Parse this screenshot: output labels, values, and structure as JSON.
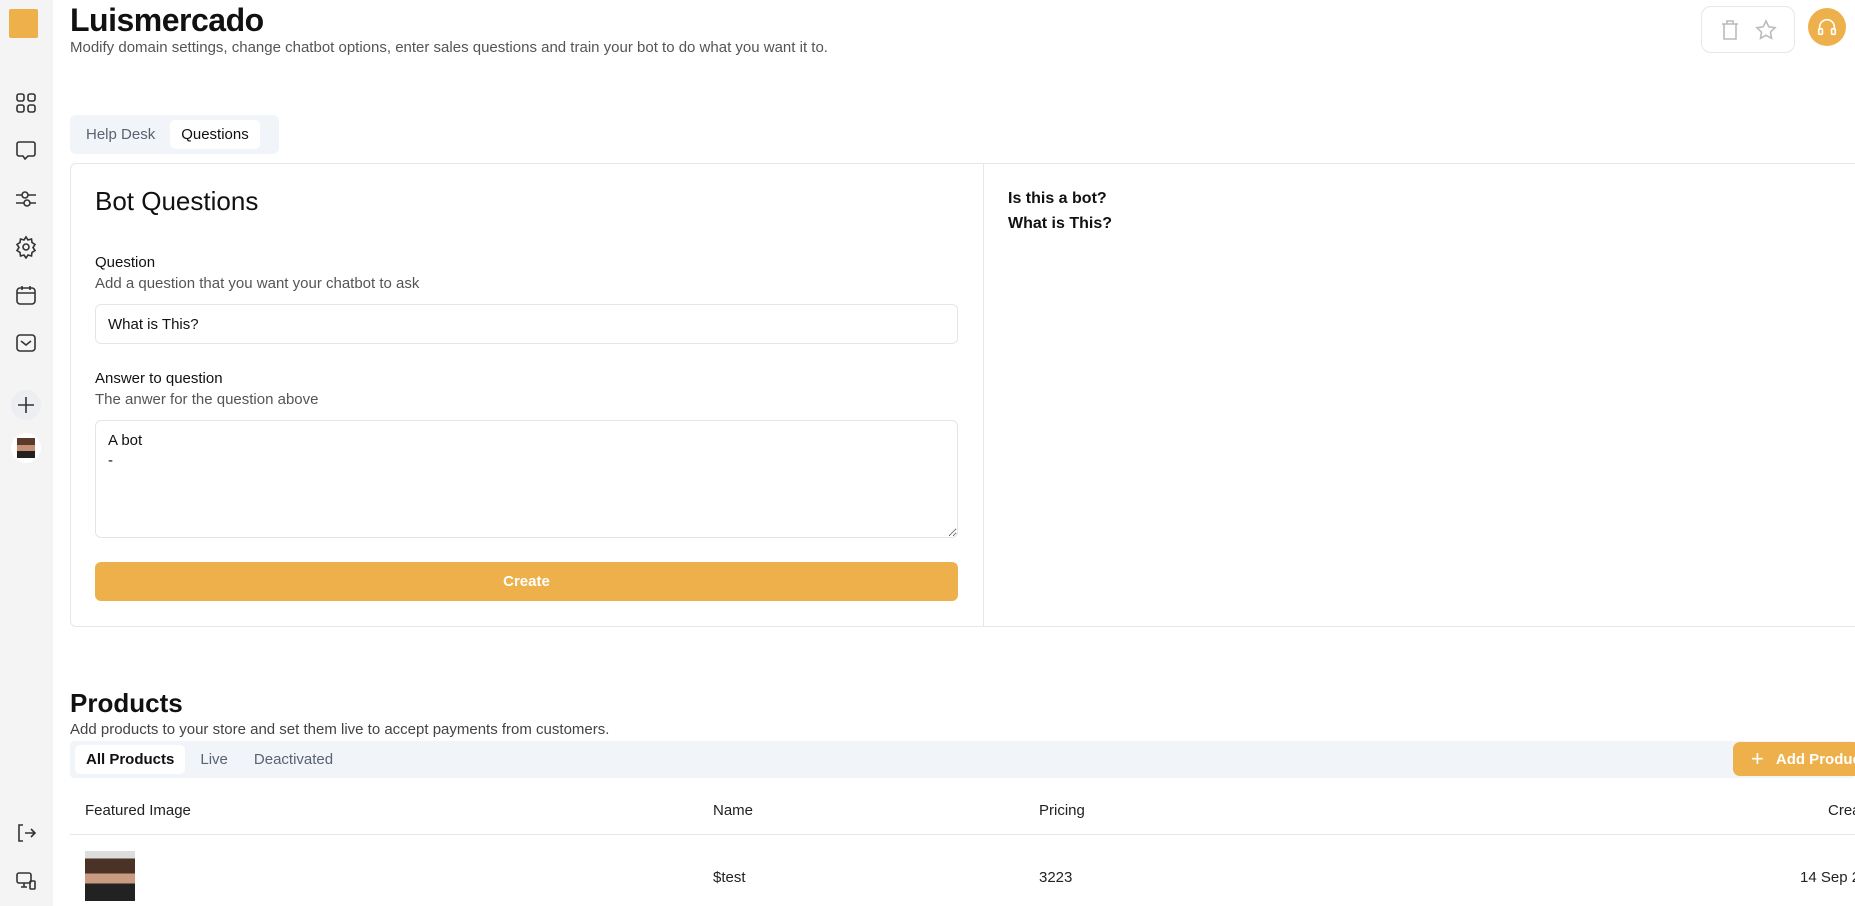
{
  "header": {
    "title": "Luismercado",
    "subtitle": "Modify domain settings, change chatbot options, enter sales questions and train your bot to do what you want it to."
  },
  "sidebar": {
    "items": [
      "dashboard-icon",
      "chat-icon",
      "sliders-icon",
      "settings-icon",
      "calendar-icon",
      "mail-icon",
      "plus-icon",
      "avatar"
    ],
    "bottom": [
      "logout-icon",
      "device-icon"
    ]
  },
  "tabs": {
    "items": [
      {
        "label": "Help Desk"
      },
      {
        "label": "Questions",
        "active": true
      }
    ]
  },
  "bot_questions": {
    "title": "Bot Questions",
    "question_label": "Question",
    "question_help": "Add a question that you want your chatbot to ask",
    "question_value": "What is This?",
    "answer_label": "Answer to question",
    "answer_help": "The anwer for the question above",
    "answer_value": "A bot\n-",
    "create_label": "Create",
    "list": [
      "Is this a bot?",
      "What is This?"
    ]
  },
  "products": {
    "title": "Products",
    "subtitle": "Add products to your store and set them live to accept payments from customers.",
    "tabs": [
      {
        "label": "All Products",
        "active": true
      },
      {
        "label": "Live"
      },
      {
        "label": "Deactivated"
      }
    ],
    "add_label": "Add Product",
    "columns": [
      "Featured Image",
      "Name",
      "Pricing",
      "Created"
    ],
    "rows": [
      {
        "name": "$test",
        "pricing": "3223",
        "created": "14 Sep 2"
      }
    ]
  },
  "colors": {
    "accent": "#eeb04a"
  }
}
